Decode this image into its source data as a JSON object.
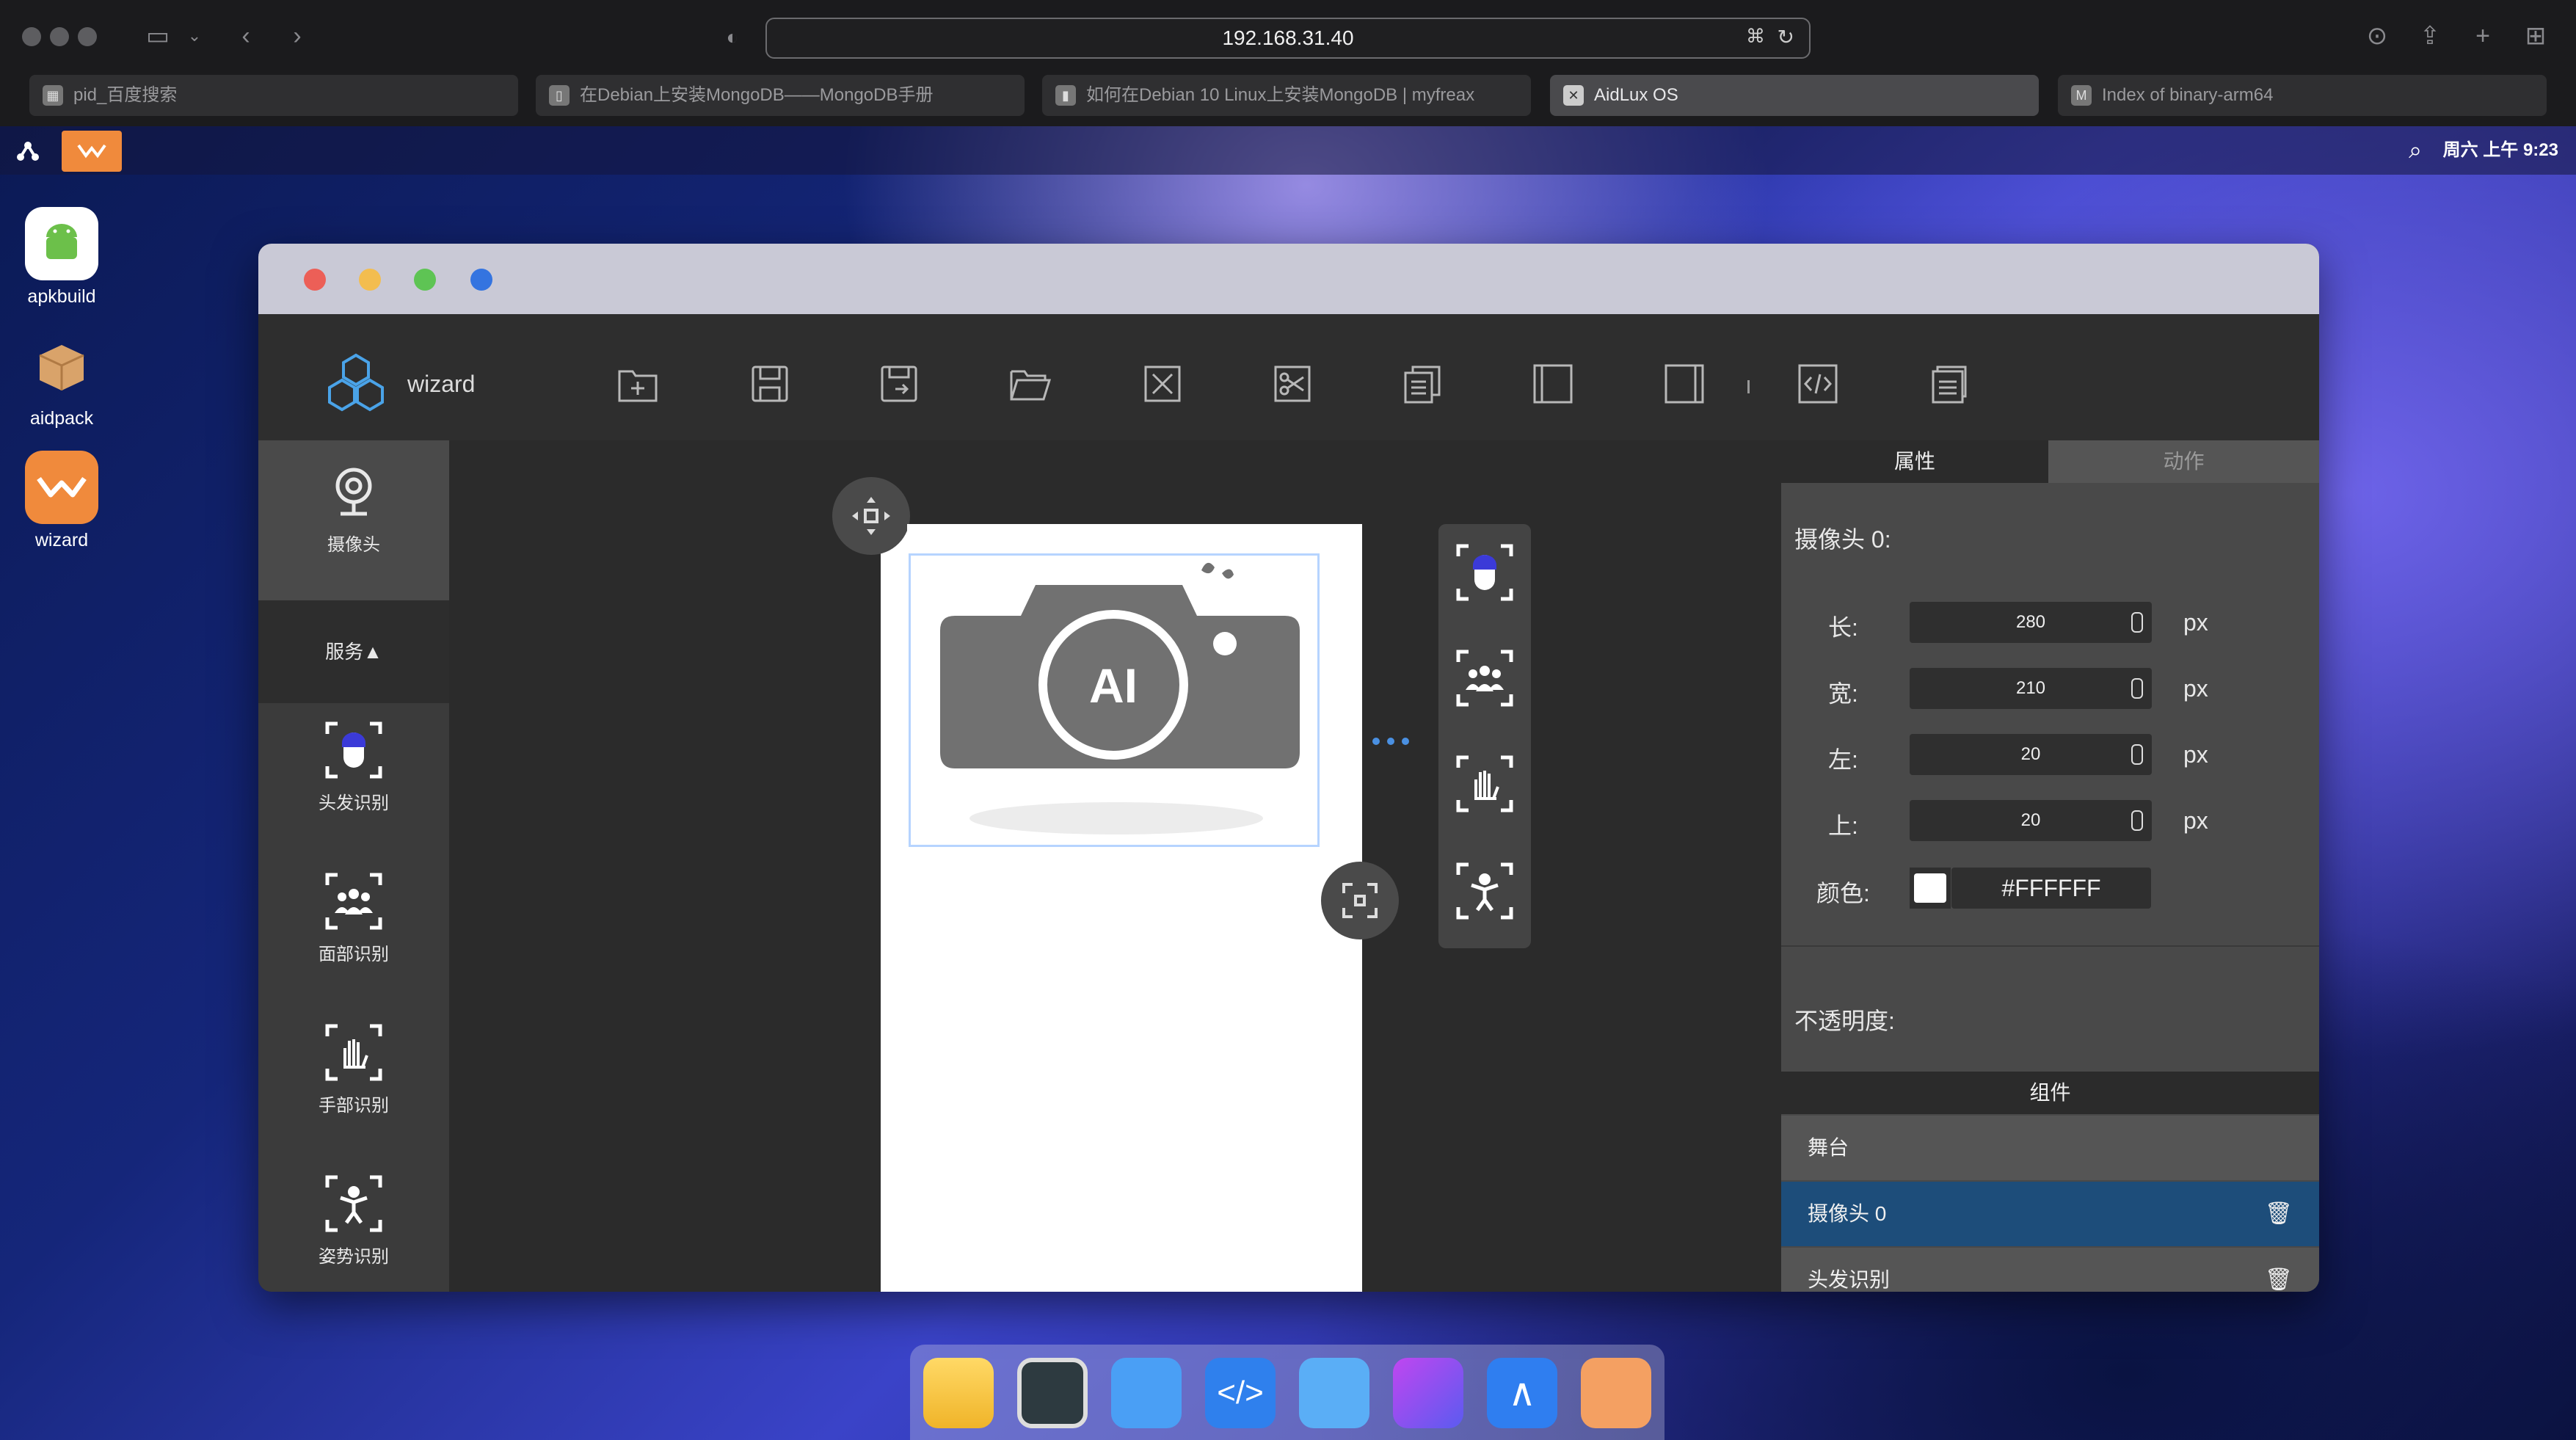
{
  "browser": {
    "url": "192.168.31.40",
    "tabs": [
      {
        "title": "pid_百度搜索"
      },
      {
        "title": "在Debian上安装MongoDB——MongoDB手册"
      },
      {
        "title": "如何在Debian 10 Linux上安装MongoDB | myfreax"
      },
      {
        "title": "AidLux OS",
        "active": true
      },
      {
        "title": "Index of binary-arm64",
        "favicon_letter": "M"
      }
    ]
  },
  "desktop": {
    "clock": "周六 上午 9:23",
    "icons": [
      {
        "label": "apkbuild"
      },
      {
        "label": "aidpack"
      },
      {
        "label": "wizard"
      }
    ]
  },
  "app": {
    "name": "wizard",
    "toolbar": [
      "new-file-icon",
      "save-icon",
      "save-as-icon",
      "open-folder-icon",
      "close-icon",
      "cut-icon",
      "copy-icon",
      "panel-left-icon",
      "panel-right-icon",
      "code-icon",
      "document-icon"
    ],
    "left_panel": {
      "camera_label": "摄像头",
      "services_label": "服务▲",
      "services": [
        {
          "label": "头发识别"
        },
        {
          "label": "面部识别"
        },
        {
          "label": "手部识别"
        },
        {
          "label": "姿势识别"
        }
      ]
    },
    "canvas": {
      "camera_image_text": "AI"
    },
    "right_panel": {
      "tabs": [
        "属性",
        "动作"
      ],
      "section_title": "摄像头 0:",
      "fields": [
        {
          "label": "长:",
          "value": "280",
          "unit": "px"
        },
        {
          "label": "宽:",
          "value": "210",
          "unit": "px"
        },
        {
          "label": "左:",
          "value": "20",
          "unit": "px"
        },
        {
          "label": "上:",
          "value": "20",
          "unit": "px"
        }
      ],
      "color_label": "颜色:",
      "color_value": "#FFFFFF",
      "opacity_label": "不透明度:",
      "components_title": "组件",
      "components": [
        {
          "label": "舞台"
        },
        {
          "label": "摄像头 0",
          "selected": true
        },
        {
          "label": "头发识别"
        }
      ]
    }
  }
}
